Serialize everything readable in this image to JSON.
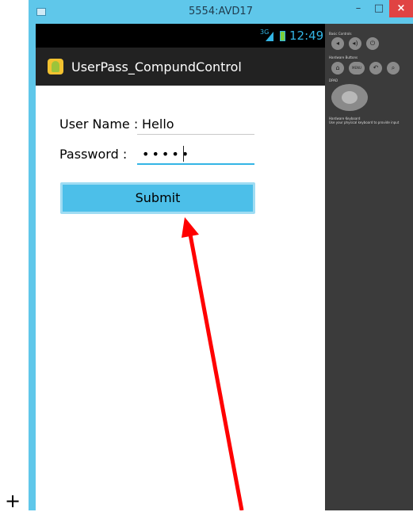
{
  "window": {
    "title": "5554:AVD17",
    "minimize_glyph": "–",
    "maximize_glyph": "□",
    "close_glyph": "×"
  },
  "status_bar": {
    "network": "3G",
    "time": "12:49"
  },
  "action_bar": {
    "title": "UserPass_CompundControl"
  },
  "form": {
    "username_label": "User Name :",
    "username_value": "Hello",
    "password_label": "Password :",
    "password_value": "•••••",
    "submit_label": "Submit"
  },
  "panel": {
    "basic_controls_label": "Basic Controls",
    "hardware_buttons_label": "Hardware Buttons",
    "dpad_label": "DPAD",
    "keyboard_label": "Hardware Keyboard",
    "keyboard_hint": "Use your physical keyboard to provide input",
    "menu_label": "MENU"
  },
  "colors": {
    "title_bar": "#5fc7ea",
    "accent": "#33b5e5",
    "submit_button": "#4cbfe9",
    "arrow": "#ff0000",
    "close_button": "#e04343"
  },
  "annotation": {
    "cursor_glyph": "+"
  }
}
